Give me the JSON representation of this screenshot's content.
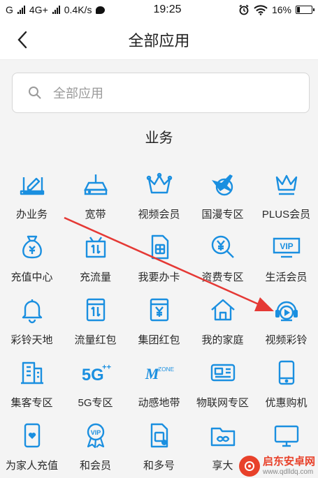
{
  "status_bar": {
    "carrier_left": "G",
    "network": "4G+",
    "speed": "0.4K/s",
    "time": "19:25",
    "battery": "16%"
  },
  "header": {
    "title": "全部应用"
  },
  "search": {
    "placeholder": "全部应用"
  },
  "section": {
    "title": "业务"
  },
  "accent_color": "#1a8fe0",
  "annotation_color": "#e53935",
  "apps": [
    [
      {
        "label": "办业务",
        "icon": "handle-business-icon"
      },
      {
        "label": "宽带",
        "icon": "router-icon"
      },
      {
        "label": "视频会员",
        "icon": "crown-icon"
      },
      {
        "label": "国漫专区",
        "icon": "globe-plane-icon"
      },
      {
        "label": "PLUS会员",
        "icon": "plus-crown-icon"
      }
    ],
    [
      {
        "label": "充值中心",
        "icon": "money-bag-icon"
      },
      {
        "label": "充流量",
        "icon": "data-gift-icon"
      },
      {
        "label": "我要办卡",
        "icon": "sim-card-icon"
      },
      {
        "label": "资费专区",
        "icon": "yuan-search-icon"
      },
      {
        "label": "生活会员",
        "icon": "vip-badge-icon"
      }
    ],
    [
      {
        "label": "彩铃天地",
        "icon": "bell-icon"
      },
      {
        "label": "流量红包",
        "icon": "data-envelope-icon"
      },
      {
        "label": "集团红包",
        "icon": "yuan-envelope-icon"
      },
      {
        "label": "我的家庭",
        "icon": "house-icon"
      },
      {
        "label": "视频彩铃",
        "icon": "video-ringtone-icon"
      }
    ],
    [
      {
        "label": "集客专区",
        "icon": "buildings-icon"
      },
      {
        "label": "5G专区",
        "icon": "5g-icon"
      },
      {
        "label": "动感地带",
        "icon": "mzone-icon"
      },
      {
        "label": "物联网专区",
        "icon": "iot-card-icon"
      },
      {
        "label": "优惠购机",
        "icon": "phone-icon"
      }
    ],
    [
      {
        "label": "为家人充值",
        "icon": "heart-phone-icon"
      },
      {
        "label": "和会员",
        "icon": "vip-medal-icon"
      },
      {
        "label": "和多号",
        "icon": "multi-sim-icon"
      },
      {
        "label": "享大",
        "icon": "folder-icon"
      },
      {
        "label": "",
        "icon": "monitor-icon"
      }
    ]
  ],
  "watermark": {
    "name": "启东安卓网",
    "url": "www.qdlldq.com"
  }
}
